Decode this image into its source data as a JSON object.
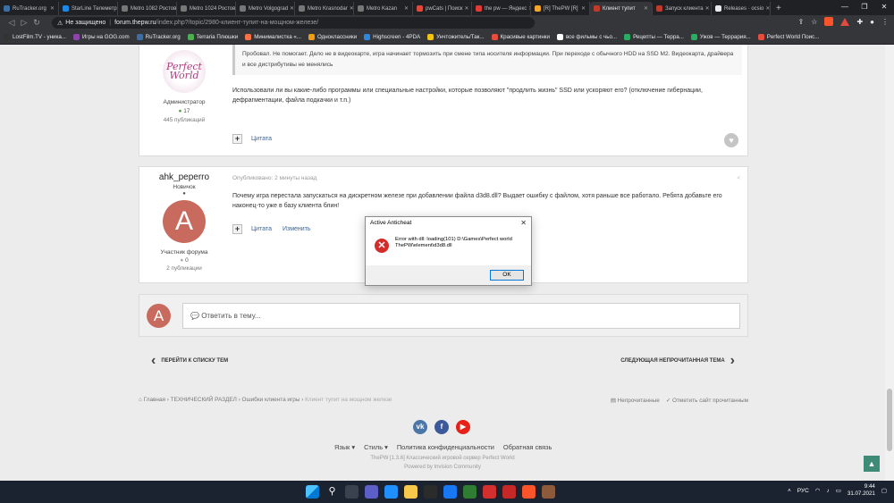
{
  "browser": {
    "tabs": [
      {
        "label": "RuTracker.org",
        "color": "#3b6ea5",
        "active": false
      },
      {
        "label": "StarLine Телеметрия",
        "color": "#1e88e5",
        "active": false
      },
      {
        "label": "Metro 1082 Ростов",
        "color": "#777777",
        "active": false
      },
      {
        "label": "Metro 1024 Ростов",
        "color": "#777777",
        "active": false
      },
      {
        "label": "Metro Volgograd",
        "color": "#777777",
        "active": false
      },
      {
        "label": "Metro Krasnodar",
        "color": "#777777",
        "active": false
      },
      {
        "label": "Metro Kazan",
        "color": "#777777",
        "active": false
      },
      {
        "label": "pwCats | Поиск",
        "color": "#e0493a",
        "active": false
      },
      {
        "label": "the pw — Яндекс",
        "color": "#e53935",
        "active": false
      },
      {
        "label": "[R] ThePW [R]",
        "color": "#f4a62a",
        "active": false
      },
      {
        "label": "Клиент тупит",
        "color": "#c0392b",
        "active": true
      },
      {
        "label": "Запуск клиента",
        "color": "#c0392b",
        "active": false
      },
      {
        "label": "Releases · ocsio",
        "color": "#e8eaed",
        "active": false
      }
    ],
    "new_tab": "+",
    "security_label": "Не защищено",
    "url_host": "forum.thepw.ru",
    "url_path": "/index.php?/topic/2980-клиент-тупит-на-мощном-железе/",
    "bookmarks": [
      {
        "label": "LostFilm.TV - уника...",
        "color": "#333333"
      },
      {
        "label": "Игры на GOG.com",
        "color": "#8e44ad"
      },
      {
        "label": "RuTracker.org",
        "color": "#3b6ea5"
      },
      {
        "label": "Terraria Плюшки",
        "color": "#4caf50"
      },
      {
        "label": "Минималистка «...",
        "color": "#ff7043"
      },
      {
        "label": "Одноклассники",
        "color": "#f39c12"
      },
      {
        "label": "Highscreen - 4PDA",
        "color": "#2e86de"
      },
      {
        "label": "Унчтожитель/Так...",
        "color": "#f1c40f"
      },
      {
        "label": "Красивые картинки",
        "color": "#e74c3c"
      },
      {
        "label": "все фильмы с чьо...",
        "color": "#ffffff"
      },
      {
        "label": "Рецепты — Терра...",
        "color": "#27ae60"
      },
      {
        "label": "Ужов — Террария...",
        "color": "#27ae60"
      },
      {
        "label": "Perfect World Поис...",
        "color": "#e74c3c"
      }
    ]
  },
  "post1": {
    "avatar_text_1": "Perfect",
    "avatar_text_2": "World",
    "role": "Администратор",
    "reputation": "17",
    "posts_count": "445 публикаций",
    "quote": "Пробовал. Не помогает. Дело не в видеокарте, игра начинает тормозить при смене типа носителя информации. При переходе с обычного HDD на SSD M2. Видеокарта, драйвера и все дистрибутивы не менялись",
    "text": "Использовали ли вы какие-либо программы или специальные настройки, которые позволяют \"продлить жизнь\" SSD или ускоряют его? (отключение гибернации, дефрагментации, файла подкачки и т.п.)",
    "quote_btn": "Цитата"
  },
  "post2": {
    "username": "ahk_peperro",
    "rank": "Новичок",
    "avatar_letter": "A",
    "group": "Участник форума",
    "reputation": "0",
    "posts_count": "2 публикации",
    "meta": "Опубликовано: 2 минуты назад",
    "text": "Почему игра перестала запускаться на дискретном железе при добавлении файла d3d8.dll? Выдает ошибку с файлом, хотя раньше все работало. Ребята добавьте его наконец-то уже в базу клиента блин!",
    "quote_btn": "Цитата",
    "edit_btn": "Изменить"
  },
  "reply": {
    "avatar_letter": "A",
    "placeholder": "Ответить в тему..."
  },
  "nav": {
    "prev": "ПЕРЕЙТИ К СПИСКУ ТЕМ",
    "next": "СЛЕДУЮЩАЯ НЕПРОЧИТАННАЯ ТЕМА"
  },
  "breadcrumb": {
    "home": "Главная",
    "section": "ТЕХНИЧЕСКИЙ РАЗДЕЛ",
    "subsection": "Ошибки клиента игры",
    "current": "Клиент тупит на мощном железе",
    "unread": "Непрочитанные",
    "mark_read": "Отметить сайт прочитанным"
  },
  "footer": {
    "language": "Язык",
    "style": "Стиль",
    "privacy": "Политика конфиденциальности",
    "contact": "Обратная связь",
    "copyright": "ThePW [1.3.6] Классический игровой сервер Perfect World",
    "powered": "Powered by Invision Community"
  },
  "dialog": {
    "title": "Active Anticheat",
    "message": "Error with dll: loading(101) D:\\Games\\Perfect world ThePW\\element\\d3d8.dll",
    "ok": "OK"
  },
  "taskbar": {
    "lang": "РУС",
    "time": "9:44",
    "date": "31.07.2021"
  }
}
